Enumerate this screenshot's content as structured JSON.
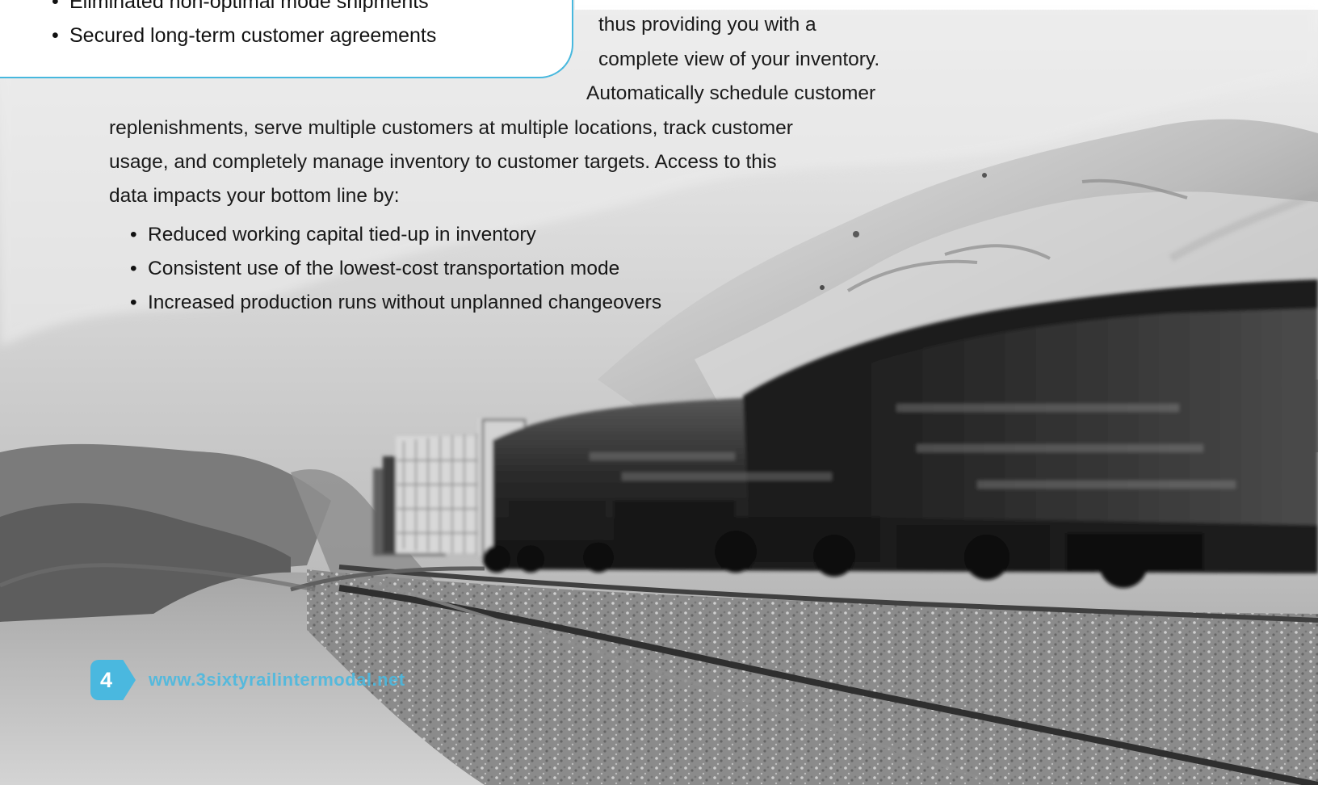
{
  "callout": {
    "items": [
      "Eliminated non-optimal mode shipments",
      "Secured long-term customer agreements"
    ]
  },
  "body": {
    "lines": [
      "thus providing you with a",
      "complete view of your inventory.",
      "Automatically schedule customer",
      "replenishments, serve multiple customers at multiple locations, track customer",
      "usage, and completely manage inventory to customer targets. Access to this",
      "data impacts your bottom line by:"
    ],
    "bullets": [
      "Reduced working capital tied-up in inventory",
      "Consistent use of the lowest-cost transportation mode",
      "Increased production runs without unplanned changeovers"
    ]
  },
  "footer": {
    "page_number": "4",
    "url": "www.3sixtyrailintermodal.net"
  },
  "colors": {
    "accent": "#4ab8df",
    "text": "#1a1a1a"
  }
}
